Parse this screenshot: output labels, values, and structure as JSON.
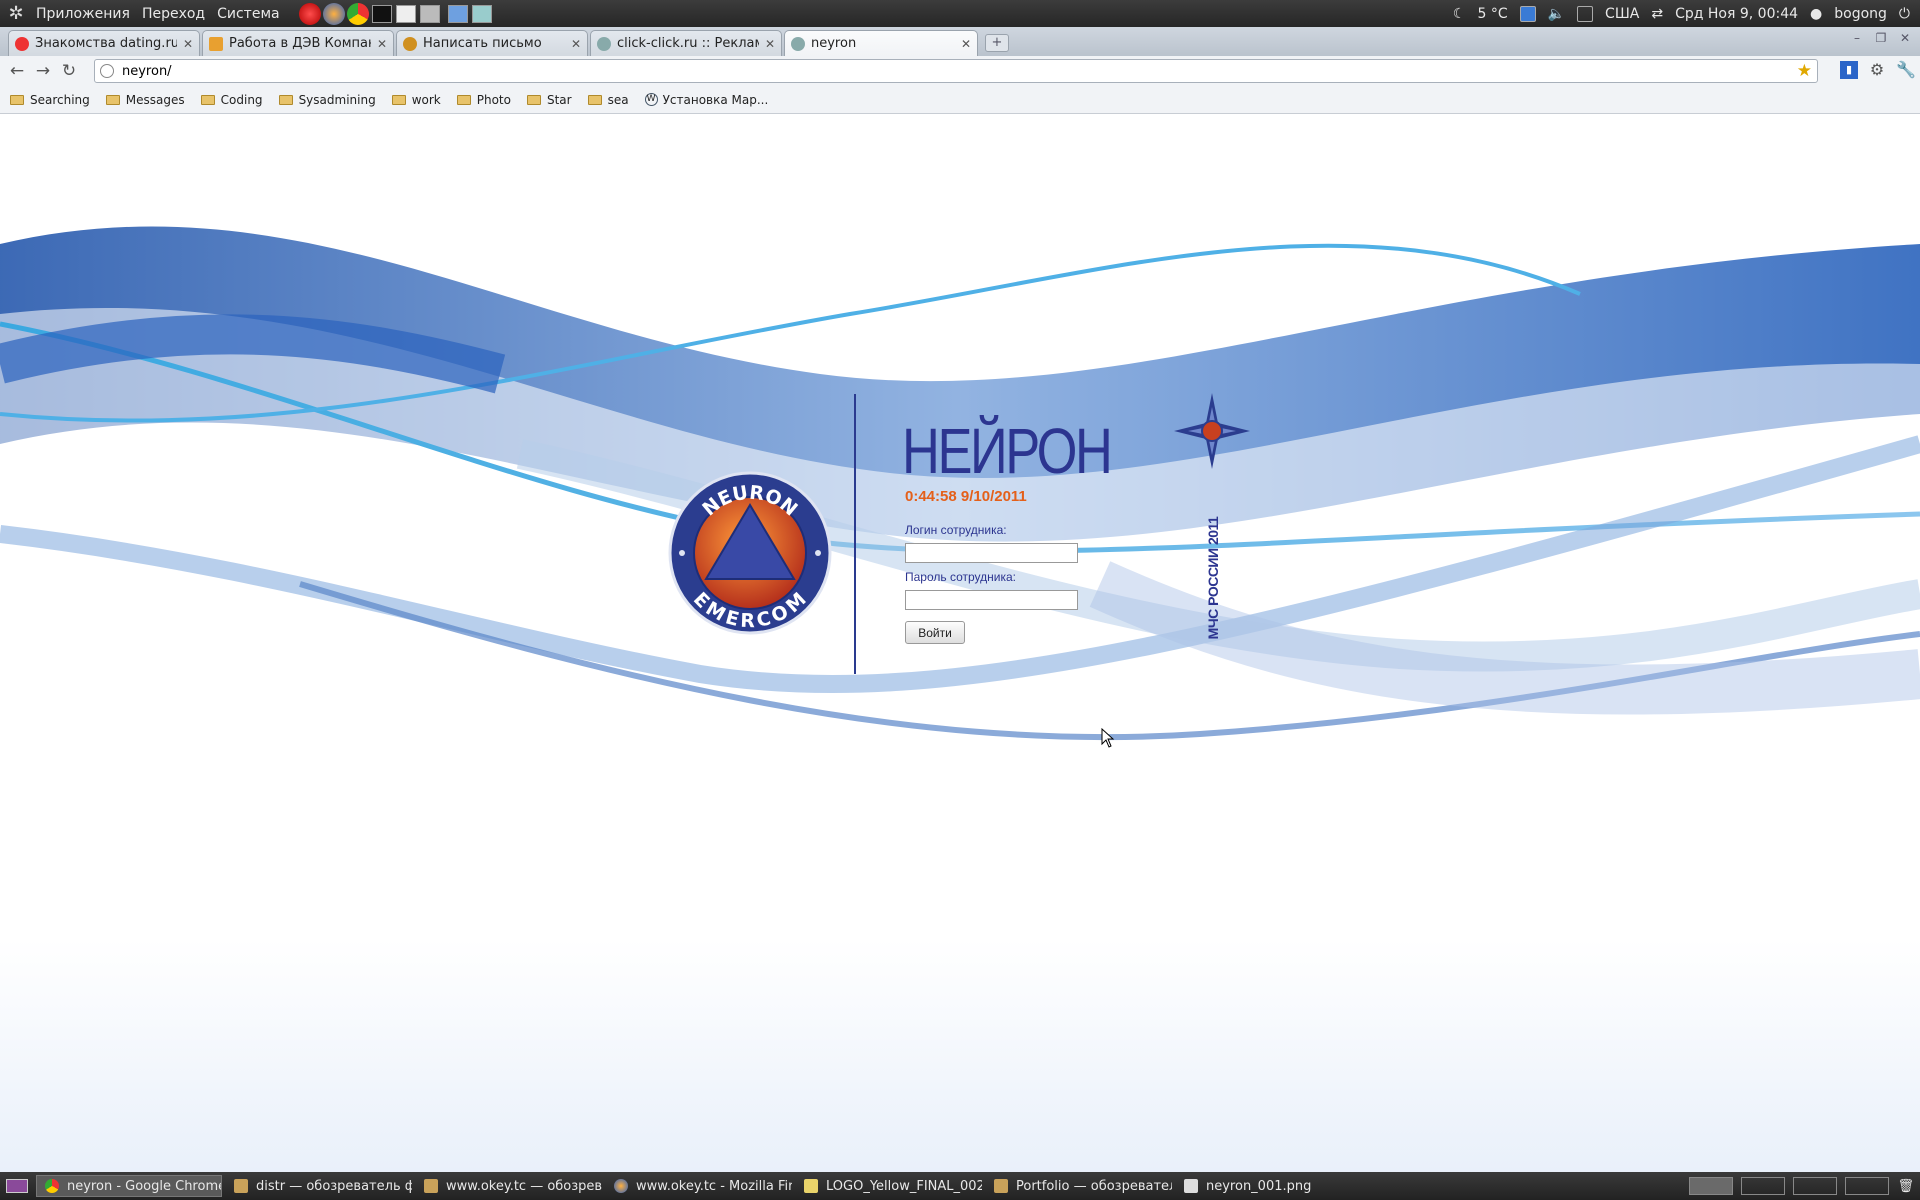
{
  "top_panel": {
    "menus": [
      "Приложения",
      "Переход",
      "Система"
    ],
    "weather": "5 °C",
    "keyboard_layout": "США",
    "datetime": "Срд Ноя  9, 00:44",
    "user": "bogong"
  },
  "tabs": [
    {
      "label": "Знакомства dating.ru, сай",
      "favicon": "dating-icon"
    },
    {
      "label": "Работа в ДЭВ Компани. |",
      "favicon": "job-icon"
    },
    {
      "label": "Написать письмо",
      "favicon": "mail-icon"
    },
    {
      "label": "click-click.ru :: Реклама в р",
      "favicon": "globe-icon"
    },
    {
      "label": "neyron",
      "favicon": "globe-icon"
    }
  ],
  "toolbar": {
    "url": "neyron/"
  },
  "bookmarks": [
    {
      "label": "Searching"
    },
    {
      "label": "Messages"
    },
    {
      "label": "Coding"
    },
    {
      "label": "Sysadmining"
    },
    {
      "label": "work"
    },
    {
      "label": "Photo"
    },
    {
      "label": "Star"
    },
    {
      "label": "sea"
    },
    {
      "label": "Установка Map..."
    }
  ],
  "page": {
    "title": "НЕЙРОН",
    "clock": "0:44:58 9/10/2011",
    "login_label": "Логин сотрудника:",
    "password_label": "Пароль сотрудника:",
    "login_value": "",
    "password_value": "",
    "submit_label": "Войти",
    "logo_top_text": "NEURON",
    "logo_bottom_text": "EMERCOM",
    "vertical_caption": "МЧС РОССИИ 2011",
    "colors": {
      "brand_blue": "#2c3590",
      "clock_orange": "#e4601a",
      "logo_ring": "#2b3d8f",
      "logo_inner": "#c8401f"
    }
  },
  "taskbar": [
    {
      "label": "neyron - Google Chrome",
      "icon": "chrome-icon"
    },
    {
      "label": "distr — обозреватель ф...",
      "icon": "folder-icon"
    },
    {
      "label": "www.okey.tc — обозрев...",
      "icon": "folder-icon"
    },
    {
      "label": "www.okey.tc - Mozilla Fir...",
      "icon": "firefox-icon"
    },
    {
      "label": "LOGO_Yellow_FINAL_002",
      "icon": "document-icon"
    },
    {
      "label": "Portfolio — обозревател...",
      "icon": "folder-icon"
    },
    {
      "label": "neyron_001.png",
      "icon": "image-icon"
    }
  ]
}
